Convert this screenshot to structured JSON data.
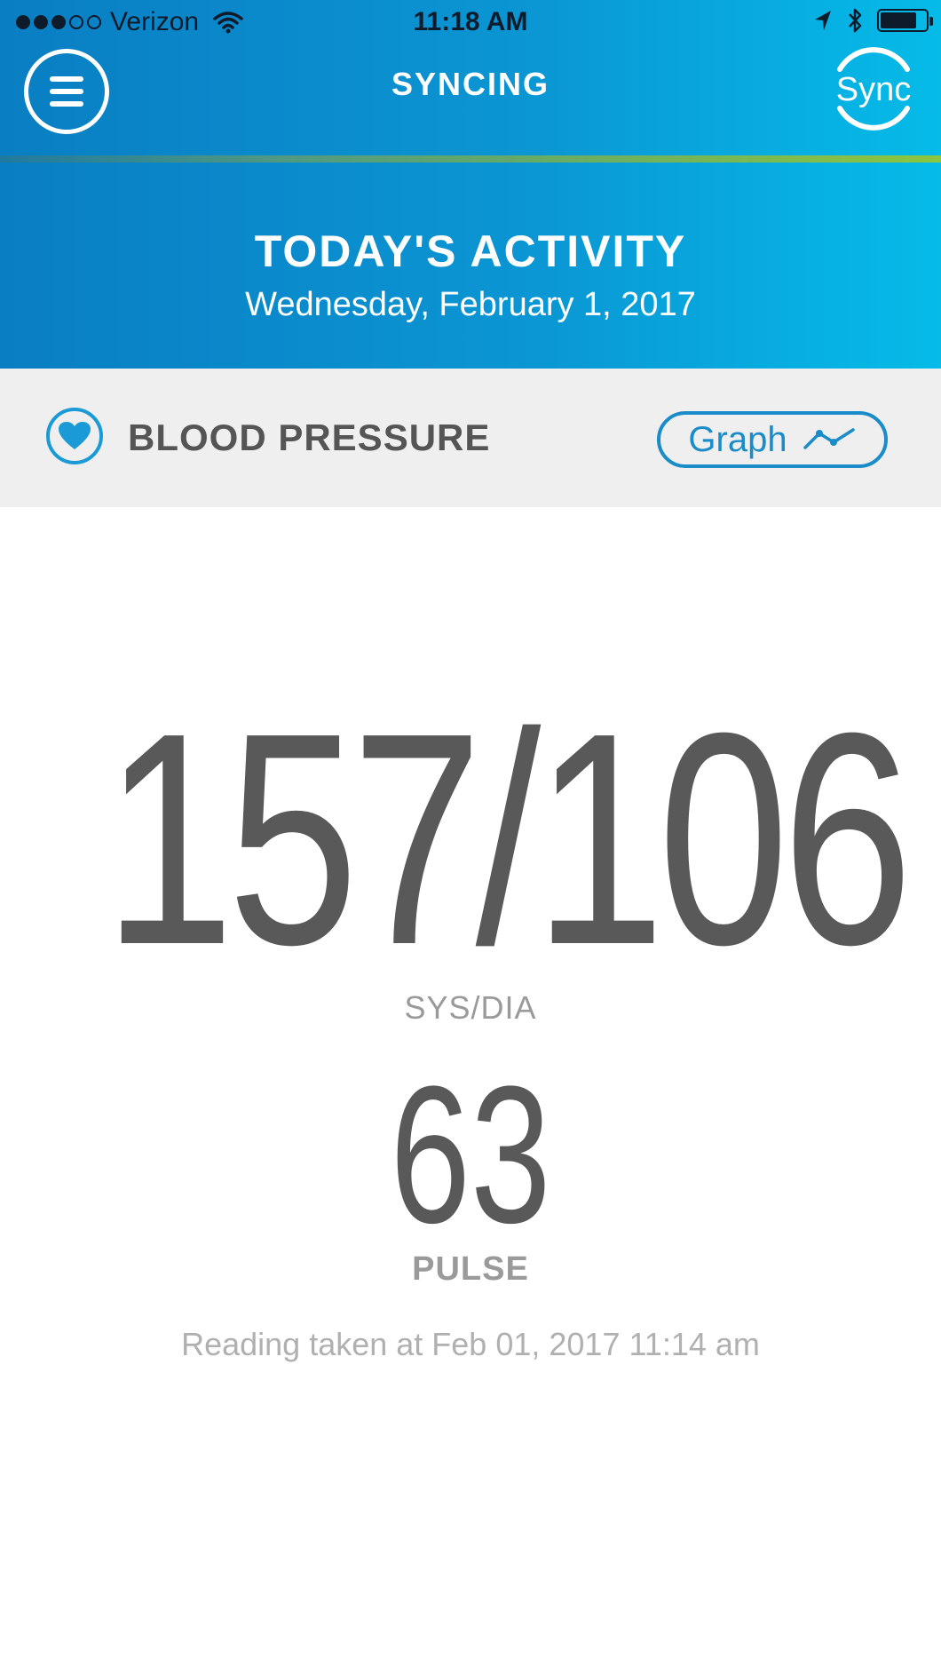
{
  "status_bar": {
    "carrier": "Verizon",
    "time": "11:18 AM",
    "signal_bars_filled": 3,
    "signal_bars_total": 5,
    "battery_level": 0.8,
    "icons": [
      "wifi-icon",
      "location-arrow-icon",
      "bluetooth-icon",
      "battery-icon"
    ]
  },
  "nav": {
    "title": "SYNCING",
    "menu_icon": "hamburger-menu-icon",
    "sync_label": "Sync"
  },
  "activity": {
    "title": "TODAY'S ACTIVITY",
    "date": "Wednesday, February 1, 2017"
  },
  "metric": {
    "title": "BLOOD PRESSURE",
    "icon": "heart-icon",
    "graph_label": "Graph",
    "graph_icon": "line-graph-icon"
  },
  "reading": {
    "bp_value": "157/106",
    "bp_label": "SYS/DIA",
    "pulse_value": "63",
    "pulse_label": "PULSE",
    "note": "Reading taken at Feb 01, 2017 11:14 am"
  },
  "colors": {
    "header_blue_left": "#0a7ec3",
    "header_blue_right": "#05bbe8",
    "accent_green": "#8cc63f",
    "link_blue": "#1a8cc9",
    "value_gray": "#595959",
    "label_gray": "#9a9a9a"
  }
}
